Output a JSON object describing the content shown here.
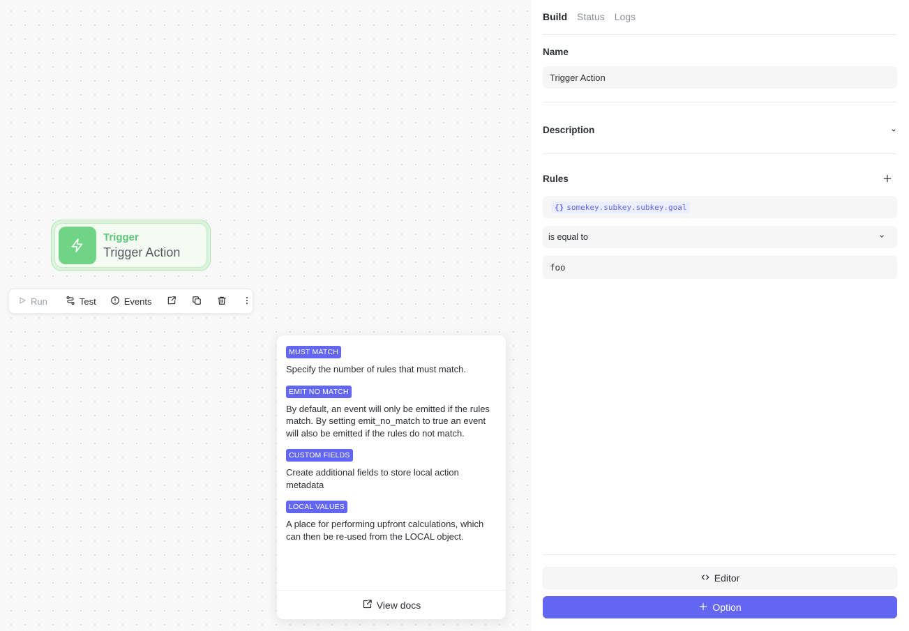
{
  "node": {
    "kind": "Trigger",
    "title": "Trigger Action",
    "icon": "lightning-icon",
    "accent": "#6fd584"
  },
  "toolbar": {
    "run_label": "Run",
    "test_label": "Test",
    "events_label": "Events",
    "icons": [
      "open-external-icon",
      "duplicate-icon",
      "trash-icon",
      "more-vertical-icon"
    ]
  },
  "help": {
    "items": [
      {
        "badge": "MUST MATCH",
        "text": "Specify the number of rules that must match."
      },
      {
        "badge": "EMIT NO MATCH",
        "text": "By default, an event will only be emitted if the rules match. By setting emit_no_match to true an event will also be emitted if the rules do not match."
      },
      {
        "badge": "CUSTOM FIELDS",
        "text": "Create additional fields to store local action metadata"
      },
      {
        "badge": "LOCAL VALUES",
        "text": "A place for performing upfront calculations, which can then be re-used from the LOCAL object."
      }
    ],
    "docs_label": "View docs",
    "badge_color": "#6366f1"
  },
  "panel": {
    "tabs": [
      {
        "label": "Build",
        "active": true
      },
      {
        "label": "Status",
        "active": false
      },
      {
        "label": "Logs",
        "active": false
      }
    ],
    "name_label": "Name",
    "name_value": "Trigger Action",
    "description_label": "Description",
    "rules_label": "Rules",
    "rule": {
      "path": "somekey.subkey.subkey.goal",
      "operator": "is equal to",
      "value": "foo"
    },
    "editor_label": "Editor",
    "option_label": "Option",
    "primary_color": "#6366f1"
  }
}
